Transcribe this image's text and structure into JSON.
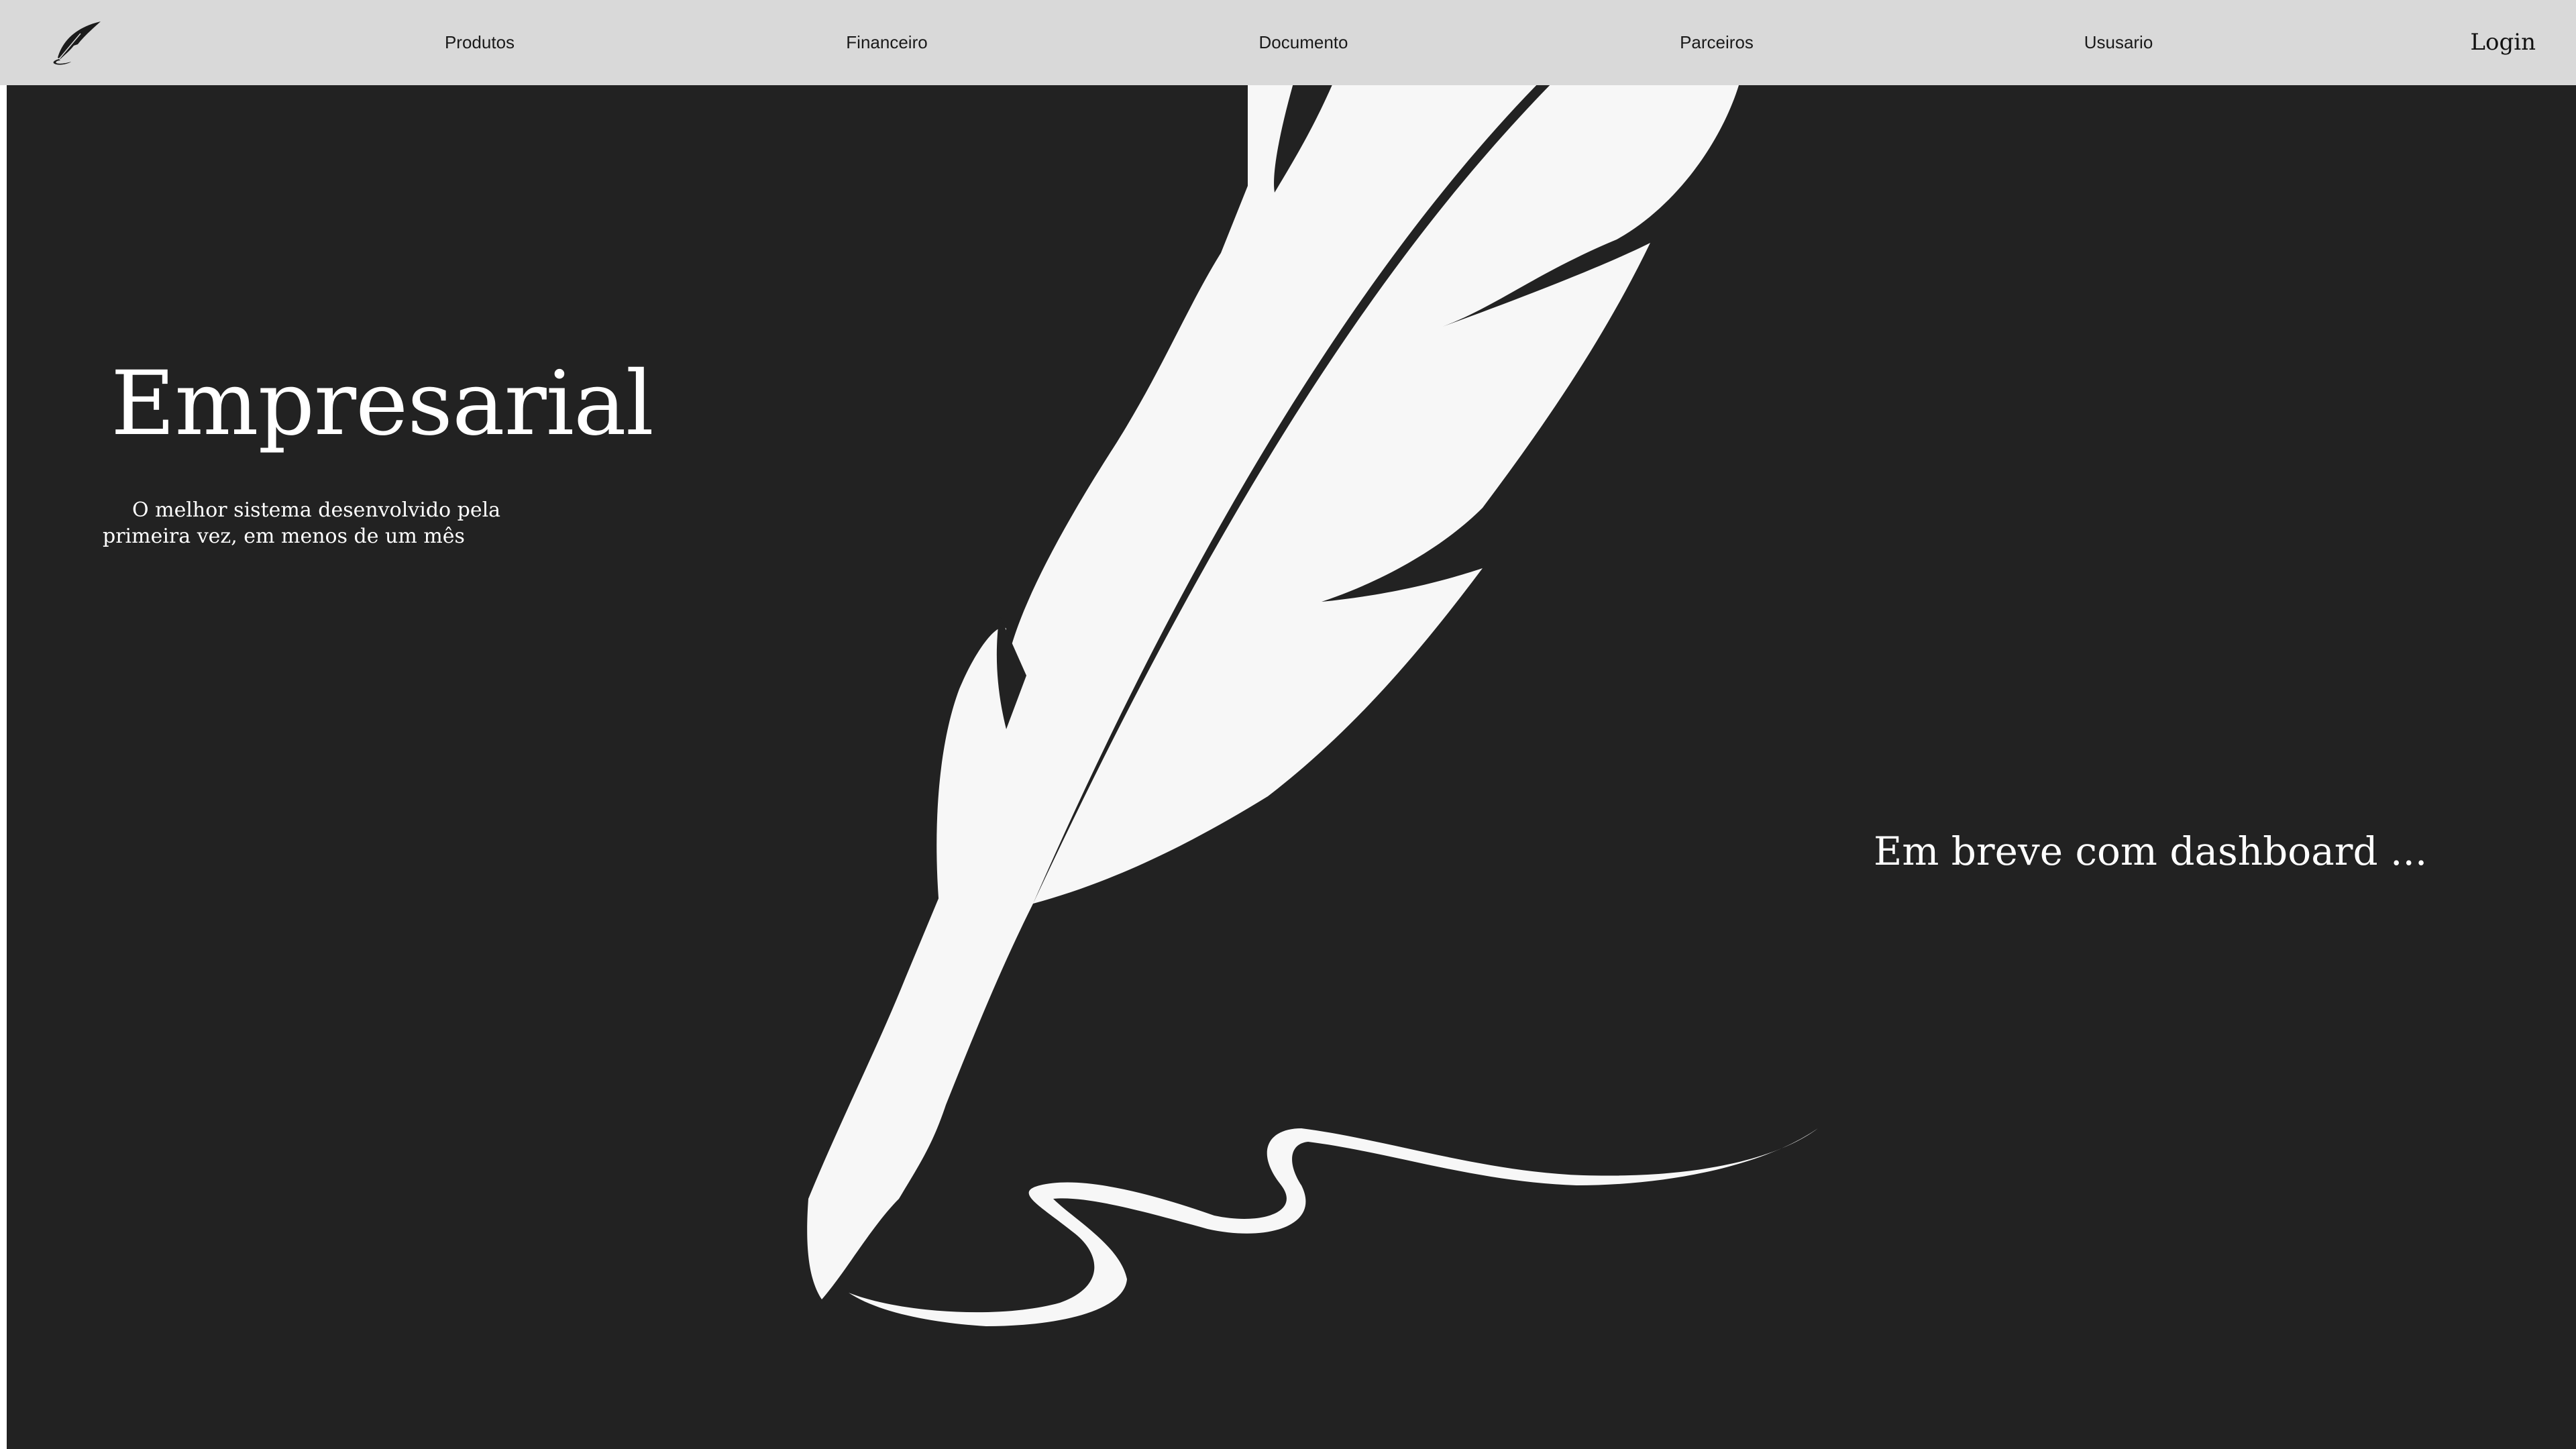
{
  "nav": {
    "logo_icon": "quill-feather-icon",
    "items": [
      {
        "label": "Produtos"
      },
      {
        "label": "Financeiro"
      },
      {
        "label": "Documento"
      },
      {
        "label": "Parceiros"
      },
      {
        "label": "Ususario"
      }
    ],
    "login_label": "Login"
  },
  "hero": {
    "title": "Empresarial",
    "subtitle": "O melhor sistema desenvolvido pela primeira vez, em menos de um mês",
    "coming_soon": "Em breve com dashboard ...",
    "illustration": "quill-feather-signature-illustration"
  },
  "colors": {
    "navbar_bg": "#d9d9d9",
    "hero_bg": "#222222",
    "text_light": "#ffffff",
    "feather": "#f7f7f7"
  }
}
